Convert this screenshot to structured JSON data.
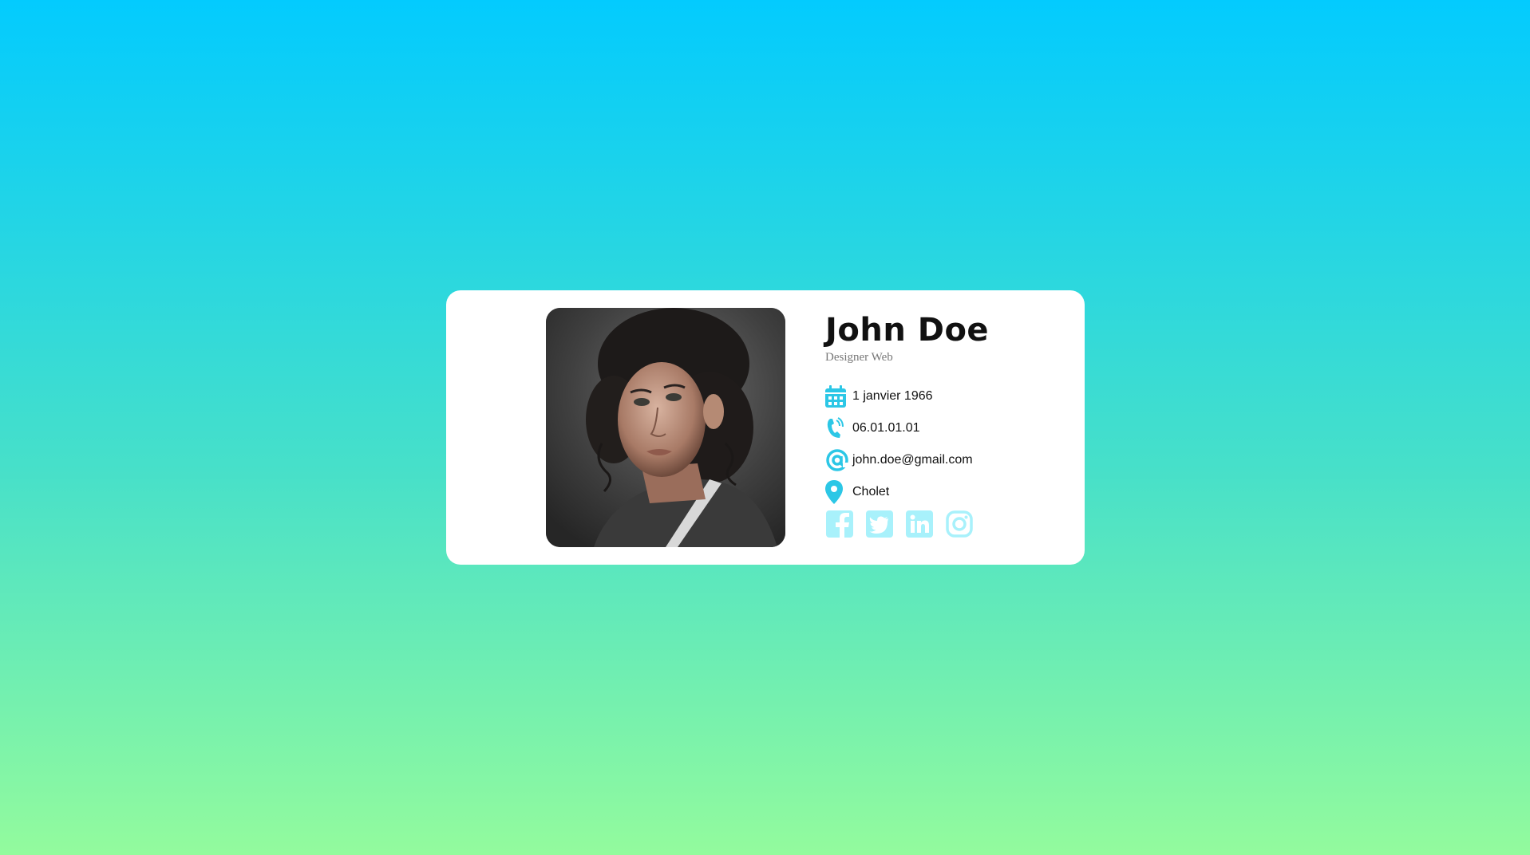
{
  "profile": {
    "name": "John Doe",
    "job": "Designer Web",
    "birthdate": "1 janvier 1966",
    "phone": "06.01.01.01",
    "email": "john.doe@gmail.com",
    "city": "Cholet"
  },
  "icons": {
    "birthdate": "calendar-icon",
    "phone": "phone-icon",
    "email": "at-icon",
    "city": "location-pin-icon"
  },
  "socials": [
    "facebook-icon",
    "twitter-icon",
    "linkedin-icon",
    "instagram-icon"
  ],
  "colors": {
    "accent": "#2cc7e6",
    "social": "#a8f1fb",
    "bg_top": "#03cbfe",
    "bg_bottom": "#93fb9d"
  }
}
